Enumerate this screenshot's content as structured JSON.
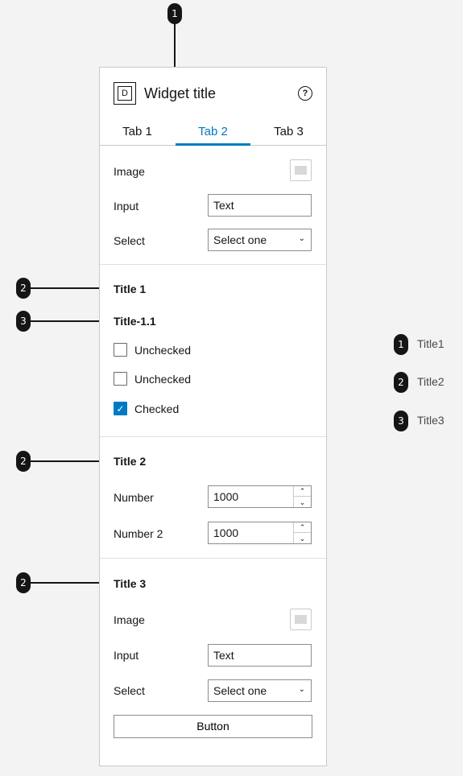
{
  "markers": {
    "m1": "1",
    "m2": "2",
    "m3": "3"
  },
  "widget": {
    "title": "Widget title",
    "title_icon_letter": "D",
    "help_glyph": "?",
    "tabs": [
      {
        "label": "Tab 1"
      },
      {
        "label": "Tab 2"
      },
      {
        "label": "Tab 3"
      }
    ],
    "active_tab": "Tab 2",
    "accent_color": "#007ac2"
  },
  "top_section": {
    "image_label": "Image",
    "input_label": "Input",
    "input_value": "Text",
    "select_label": "Select",
    "select_value": "Select one"
  },
  "section1": {
    "title": "Title 1",
    "subtitle": "Title-1.1",
    "checkboxes": [
      {
        "label": "Unchecked",
        "checked": false
      },
      {
        "label": "Unchecked",
        "checked": false
      },
      {
        "label": "Checked",
        "checked": true
      }
    ]
  },
  "section2": {
    "title": "Title 2",
    "number_label": "Number",
    "number_value": "1000",
    "number2_label": "Number 2",
    "number2_value": "1000"
  },
  "section3": {
    "title": "Title 3",
    "image_label": "Image",
    "input_label": "Input",
    "input_value": "Text",
    "select_label": "Select",
    "select_value": "Select one",
    "button_label": "Button"
  },
  "legend": [
    {
      "num": "1",
      "text": "Title1"
    },
    {
      "num": "2",
      "text": "Title2"
    },
    {
      "num": "3",
      "text": "Title3"
    }
  ]
}
